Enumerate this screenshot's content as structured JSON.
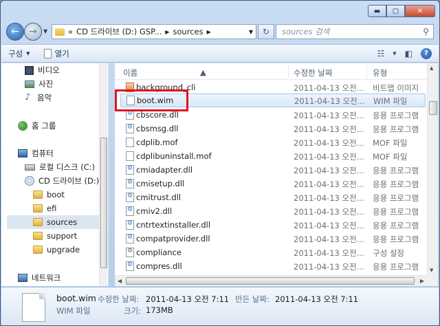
{
  "window": {
    "caption": {
      "minimize": "▬",
      "maximize": "▢",
      "close": "✕"
    }
  },
  "address": {
    "overflow": "«",
    "segments": [
      "CD 드라이브 (D:) GSP...",
      "sources"
    ],
    "search_placeholder": "sources 검색"
  },
  "toolbar": {
    "organize": "구성",
    "open": "열기"
  },
  "nav": {
    "items": [
      {
        "label": "비디오",
        "icon": "video-icon"
      },
      {
        "label": "사진",
        "icon": "photo-icon"
      },
      {
        "label": "음악",
        "icon": "music-icon"
      },
      {
        "label": "홈 그룹",
        "icon": "homegroup-icon"
      },
      {
        "label": "컴퓨터",
        "icon": "computer-icon"
      },
      {
        "label": "로컬 디스크 (C:)",
        "icon": "drive-icon"
      },
      {
        "label": "CD 드라이브 (D:)",
        "icon": "cd-icon"
      },
      {
        "label": "boot",
        "icon": "folder-icon"
      },
      {
        "label": "efi",
        "icon": "folder-icon"
      },
      {
        "label": "sources",
        "icon": "folder-icon",
        "selected": true
      },
      {
        "label": "support",
        "icon": "folder-icon"
      },
      {
        "label": "upgrade",
        "icon": "folder-icon"
      },
      {
        "label": "네트워크",
        "icon": "network-icon"
      }
    ]
  },
  "columns": {
    "name": "이름",
    "date": "수정한 날짜",
    "type": "유형"
  },
  "files": [
    {
      "name": "background_cli",
      "date": "2011-04-13 오전...",
      "type": "비트맵 이미지",
      "kind": "exe"
    },
    {
      "name": "boot.wim",
      "date": "2011-04-13 오전...",
      "type": "WIM 파일",
      "kind": "doc",
      "selected": true
    },
    {
      "name": "cbscore.dll",
      "date": "2011-04-13 오전...",
      "type": "응용 프로그램",
      "kind": "dll"
    },
    {
      "name": "cbsmsg.dll",
      "date": "2011-04-13 오전...",
      "type": "응용 프로그램",
      "kind": "dll"
    },
    {
      "name": "cdplib.mof",
      "date": "2011-04-13 오전...",
      "type": "MOF 파일",
      "kind": "mof"
    },
    {
      "name": "cdplibuninstall.mof",
      "date": "2011-04-13 오전...",
      "type": "MOF 파일",
      "kind": "mof"
    },
    {
      "name": "cmiadapter.dll",
      "date": "2011-04-13 오전...",
      "type": "응용 프로그램",
      "kind": "dll"
    },
    {
      "name": "cmisetup.dll",
      "date": "2011-04-13 오전...",
      "type": "응용 프로그램",
      "kind": "dll"
    },
    {
      "name": "cmitrust.dll",
      "date": "2011-04-13 오전...",
      "type": "응용 프로그램",
      "kind": "dll"
    },
    {
      "name": "cmiv2.dll",
      "date": "2011-04-13 오전...",
      "type": "응용 프로그램",
      "kind": "dll"
    },
    {
      "name": "cntrtextinstaller.dll",
      "date": "2011-04-13 오전...",
      "type": "응용 프로그램",
      "kind": "dll"
    },
    {
      "name": "compatprovider.dll",
      "date": "2011-04-13 오전...",
      "type": "응용 프로그램",
      "kind": "dll"
    },
    {
      "name": "compliance",
      "date": "2011-04-13 오전...",
      "type": "구성 설정",
      "kind": "cfg"
    },
    {
      "name": "compres.dll",
      "date": "2011-04-13 오전...",
      "type": "응용 프로그램",
      "kind": "dll"
    }
  ],
  "details": {
    "name": "boot.wim",
    "type": "WIM 파일",
    "modified_label": "수정한 날짜:",
    "modified_value": "2011-04-13 오전 7:11",
    "created_label": "만든 날짜:",
    "created_value": "2011-04-13 오전 7:11",
    "size_label": "크기:",
    "size_value": "173MB"
  }
}
